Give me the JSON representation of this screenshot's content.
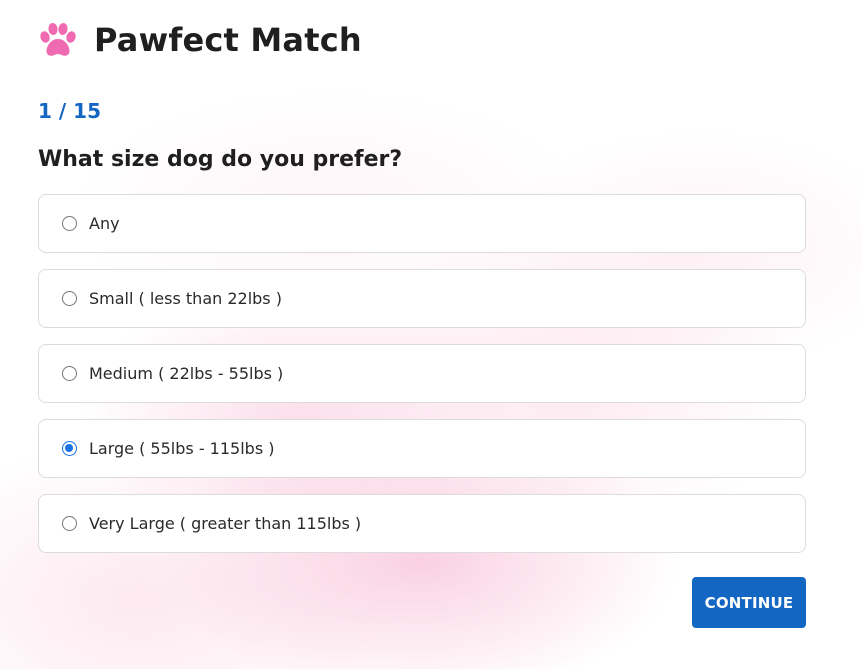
{
  "brand": {
    "name": "Pawfect Match",
    "logo_icon": "paw-icon",
    "logo_color": "#ef6ab0"
  },
  "progress": {
    "label": "1 / 15",
    "current": 1,
    "total": 15
  },
  "question": {
    "text": "What size dog do you prefer?"
  },
  "options": [
    {
      "label": "Any",
      "selected": false
    },
    {
      "label": "Small ( less than 22lbs )",
      "selected": false
    },
    {
      "label": "Medium ( 22lbs - 55lbs )",
      "selected": false
    },
    {
      "label": "Large ( 55lbs - 115lbs )",
      "selected": true
    },
    {
      "label": "Very Large ( greater than 115lbs )",
      "selected": false
    }
  ],
  "actions": {
    "continue_label": "CONTINUE"
  },
  "colors": {
    "accent": "#1466c3",
    "radio_checked": "#1a73e8",
    "background_tint": "#f7b8cf"
  }
}
